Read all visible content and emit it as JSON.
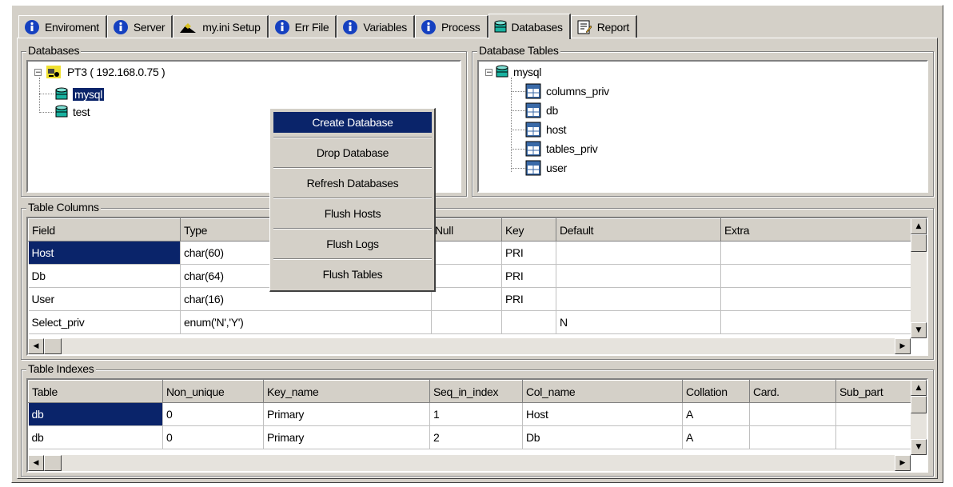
{
  "tabs": [
    {
      "label": "Enviroment",
      "icon": "info-icon"
    },
    {
      "label": "Server",
      "icon": "info-icon"
    },
    {
      "label": "my.ini Setup",
      "icon": "setup-icon"
    },
    {
      "label": "Err File",
      "icon": "info-icon"
    },
    {
      "label": "Variables",
      "icon": "info-icon"
    },
    {
      "label": "Process",
      "icon": "info-icon"
    },
    {
      "label": "Databases",
      "icon": "database-icon",
      "active": true
    },
    {
      "label": "Report",
      "icon": "report-icon"
    }
  ],
  "databases_panel": {
    "title": "Databases",
    "server": "PT3 ( 192.168.0.75 )",
    "items": [
      "mysql",
      "test"
    ],
    "selected": "mysql"
  },
  "tables_panel": {
    "title": "Database Tables",
    "database": "mysql",
    "tables": [
      "columns_priv",
      "db",
      "host",
      "tables_priv",
      "user"
    ]
  },
  "context_menu": {
    "items": [
      "Create Database",
      "Drop Database",
      "Refresh Databases",
      "Flush Hosts",
      "Flush Logs",
      "Flush Tables"
    ],
    "highlighted": "Create Database"
  },
  "columns_panel": {
    "title": "Table Columns",
    "headers": [
      "Field",
      "Type",
      "Null",
      "Key",
      "Default",
      "Extra"
    ],
    "rows": [
      [
        "Host",
        "char(60)",
        "",
        "PRI",
        "",
        ""
      ],
      [
        "Db",
        "char(64)",
        "",
        "PRI",
        "",
        ""
      ],
      [
        "User",
        "char(16)",
        "",
        "PRI",
        "",
        ""
      ],
      [
        "Select_priv",
        "enum('N','Y')",
        "",
        "",
        "N",
        ""
      ]
    ]
  },
  "indexes_panel": {
    "title": "Table Indexes",
    "headers": [
      "Table",
      "Non_unique",
      "Key_name",
      "Seq_in_index",
      "Col_name",
      "Collation",
      "Card.",
      "Sub_part"
    ],
    "rows": [
      [
        "db",
        "0",
        "Primary",
        "1",
        "Host",
        "A",
        "",
        ""
      ],
      [
        "db",
        "0",
        "Primary",
        "2",
        "Db",
        "A",
        "",
        ""
      ]
    ]
  },
  "colors": {
    "selection": "#0a246a",
    "face": "#d4d0c8",
    "db_icon": "#19b2a0"
  }
}
